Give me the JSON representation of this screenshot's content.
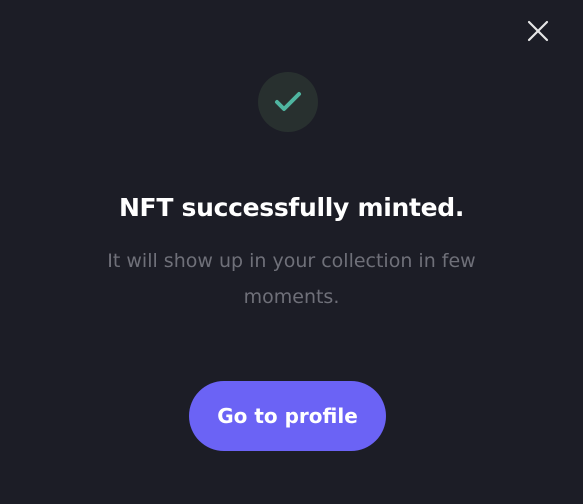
{
  "modal": {
    "title": "NFT successfully minted.",
    "description": "It will show up in your collection in few moments.",
    "primary_button_label": "Go to profile",
    "close_icon": "close-icon",
    "status_icon": "checkmark-icon"
  },
  "colors": {
    "background": "#1c1d26",
    "title_text": "#ffffff",
    "description_text": "#6f7079",
    "accent_button": "#6b63f5",
    "checkmark": "#4fb5a0",
    "checkmark_circle": "#28302f",
    "close_icon": "#e6e6e6"
  }
}
